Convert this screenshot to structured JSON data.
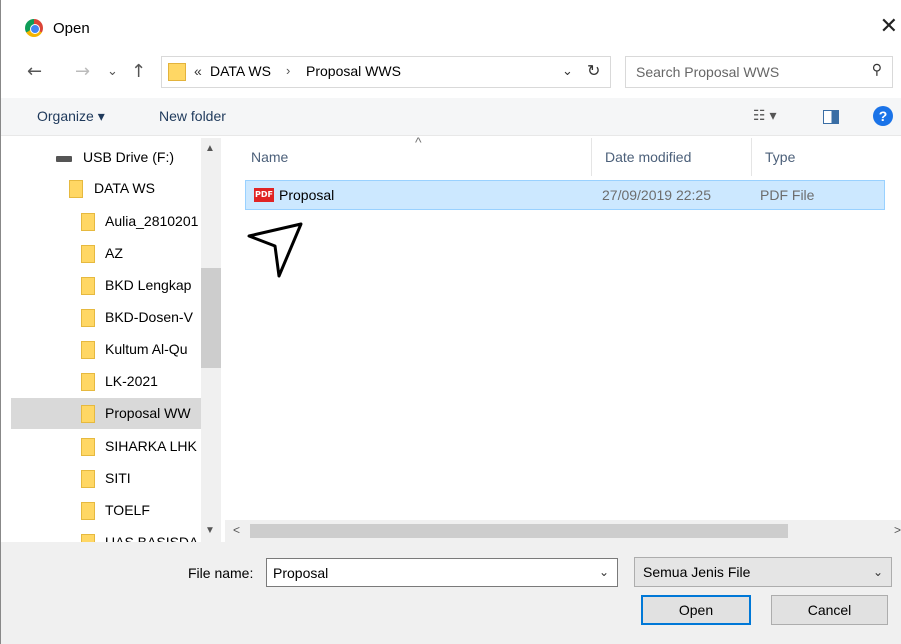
{
  "window": {
    "title": "Open",
    "app_icon": "chrome-icon",
    "close_glyph": "✕"
  },
  "nav": {
    "back": "←",
    "forward": "→",
    "recent": "⌄",
    "up": "↑"
  },
  "address": {
    "overflow": "«",
    "crumbs": [
      "DATA WS",
      "Proposal WWS"
    ],
    "separator": "›",
    "dropdown": "⌄",
    "refresh": "↻"
  },
  "search": {
    "placeholder": "Search Proposal WWS",
    "icon": "search-icon",
    "glyph": "⚲"
  },
  "toolbar": {
    "organize": "Organize ▾",
    "new_folder": "New folder",
    "view": "☷ ▾",
    "help": "?"
  },
  "sidebar": {
    "items": [
      {
        "label": "USB Drive (F:)",
        "indent": 1,
        "icon": "usb-drive-icon"
      },
      {
        "label": "DATA WS",
        "indent": 2,
        "icon": "folder-icon"
      },
      {
        "label": "Aulia_2810201",
        "indent": 3,
        "icon": "folder-icon"
      },
      {
        "label": "AZ",
        "indent": 3,
        "icon": "folder-icon"
      },
      {
        "label": "BKD Lengkap",
        "indent": 3,
        "icon": "folder-icon"
      },
      {
        "label": "BKD-Dosen-V",
        "indent": 3,
        "icon": "folder-icon"
      },
      {
        "label": "Kultum Al-Qu",
        "indent": 3,
        "icon": "folder-icon"
      },
      {
        "label": "LK-2021",
        "indent": 3,
        "icon": "folder-icon"
      },
      {
        "label": "Proposal WW",
        "indent": 3,
        "icon": "folder-icon",
        "selected": true
      },
      {
        "label": "SIHARKA LHK",
        "indent": 3,
        "icon": "folder-icon"
      },
      {
        "label": "SITI",
        "indent": 3,
        "icon": "folder-icon"
      },
      {
        "label": "TOELF",
        "indent": 3,
        "icon": "folder-icon"
      },
      {
        "label": "UAS BASISDA",
        "indent": 3,
        "icon": "folder-icon"
      }
    ],
    "scroll_up": "▲",
    "scroll_down": "▼"
  },
  "columns": {
    "name": "Name",
    "date": "Date modified",
    "type": "Type",
    "sort_glyph": "^"
  },
  "files": [
    {
      "name": "Proposal",
      "date": "27/09/2019 22:25",
      "type": "PDF File",
      "icon": "pdf-icon",
      "icon_text": "PDF"
    }
  ],
  "hscroll": {
    "left": "<",
    "right": ">"
  },
  "bottom": {
    "file_name_label": "File name:",
    "file_name_value": "Proposal",
    "file_type_value": "Semua Jenis File",
    "dropdown": "⌄",
    "open_label": "Open",
    "cancel_label": "Cancel"
  },
  "colors": {
    "selection": "#cce8ff",
    "accent": "#0078d7",
    "folder": "#ffd764"
  }
}
